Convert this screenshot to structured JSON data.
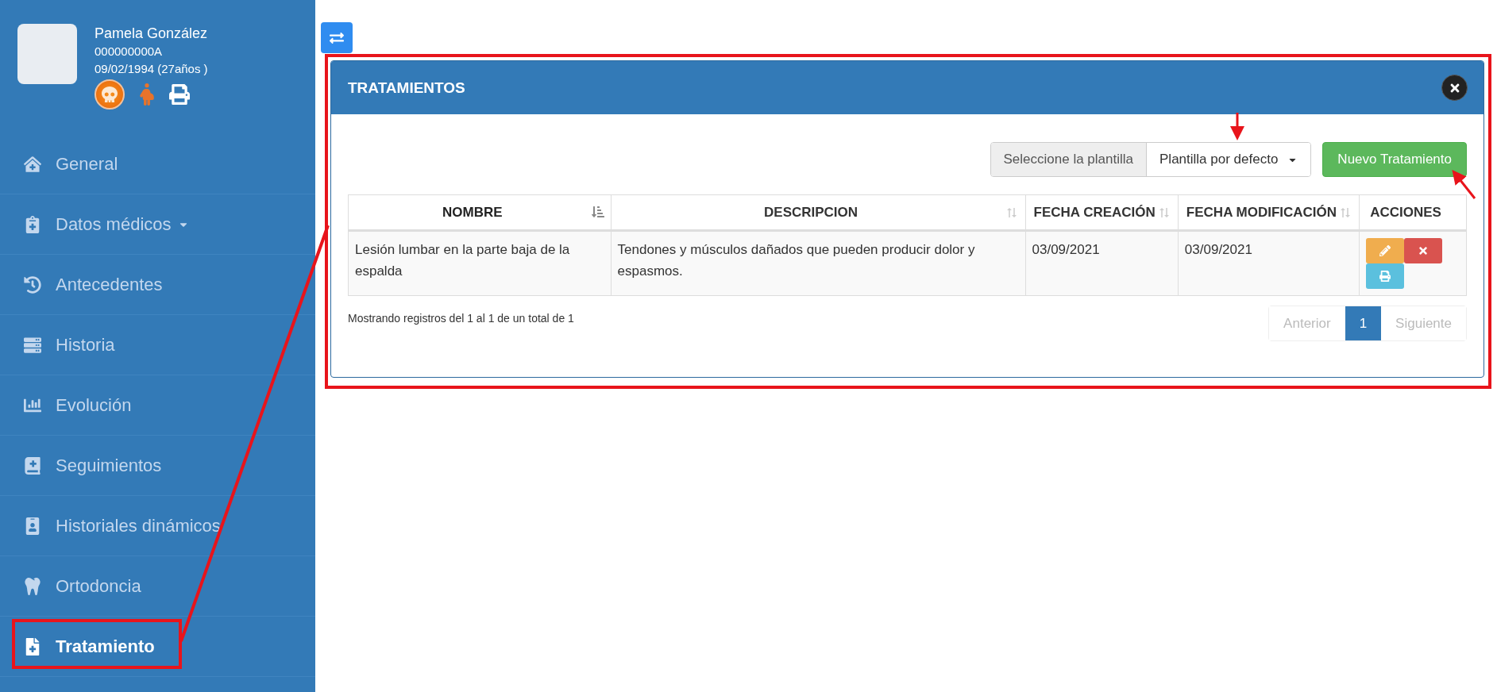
{
  "patient": {
    "name": "Pamela González",
    "id": "000000000A",
    "birth": "09/02/1994 (27años )"
  },
  "sidebar": {
    "items": [
      {
        "label": "General",
        "selected": false,
        "has_submenu": false
      },
      {
        "label": "Datos médicos",
        "selected": false,
        "has_submenu": true
      },
      {
        "label": "Antecedentes",
        "selected": false,
        "has_submenu": false
      },
      {
        "label": "Historia",
        "selected": false,
        "has_submenu": false
      },
      {
        "label": "Evolución",
        "selected": false,
        "has_submenu": false
      },
      {
        "label": "Seguimientos",
        "selected": false,
        "has_submenu": false
      },
      {
        "label": "Historiales dinámicos",
        "selected": false,
        "has_submenu": false
      },
      {
        "label": "Ortodoncia",
        "selected": false,
        "has_submenu": false
      },
      {
        "label": "Tratamiento",
        "selected": true,
        "has_submenu": false
      }
    ]
  },
  "panel": {
    "title": "TRATAMIENTOS",
    "template": {
      "label": "Seleccione la plantilla",
      "value": "Plantilla por defecto"
    },
    "new_button": "Nuevo Tratamiento",
    "table": {
      "columns": [
        {
          "label": "NOMBRE",
          "sortable": true,
          "sorted": true
        },
        {
          "label": "DESCRIPCION",
          "sortable": true,
          "sorted": false
        },
        {
          "label": "FECHA CREACIÓN",
          "sortable": true,
          "sorted": false
        },
        {
          "label": "FECHA MODIFICACIÓN",
          "sortable": true,
          "sorted": false
        },
        {
          "label": "ACCIONES",
          "sortable": false,
          "sorted": false
        }
      ],
      "rows": [
        {
          "cells": [
            "Lesión lumbar en la parte baja de la espalda",
            "Tendones y músculos dañados que pueden producir dolor y espasmos.",
            "03/09/2021",
            "03/09/2021"
          ]
        }
      ]
    },
    "info": "Mostrando registros del 1 al 1 de un total de 1",
    "pagination": {
      "previous": {
        "label": "Anterior",
        "disabled": true
      },
      "pages": [
        {
          "label": "1",
          "selected": true
        }
      ],
      "next": {
        "label": "Siguiente",
        "disabled": true
      }
    }
  }
}
